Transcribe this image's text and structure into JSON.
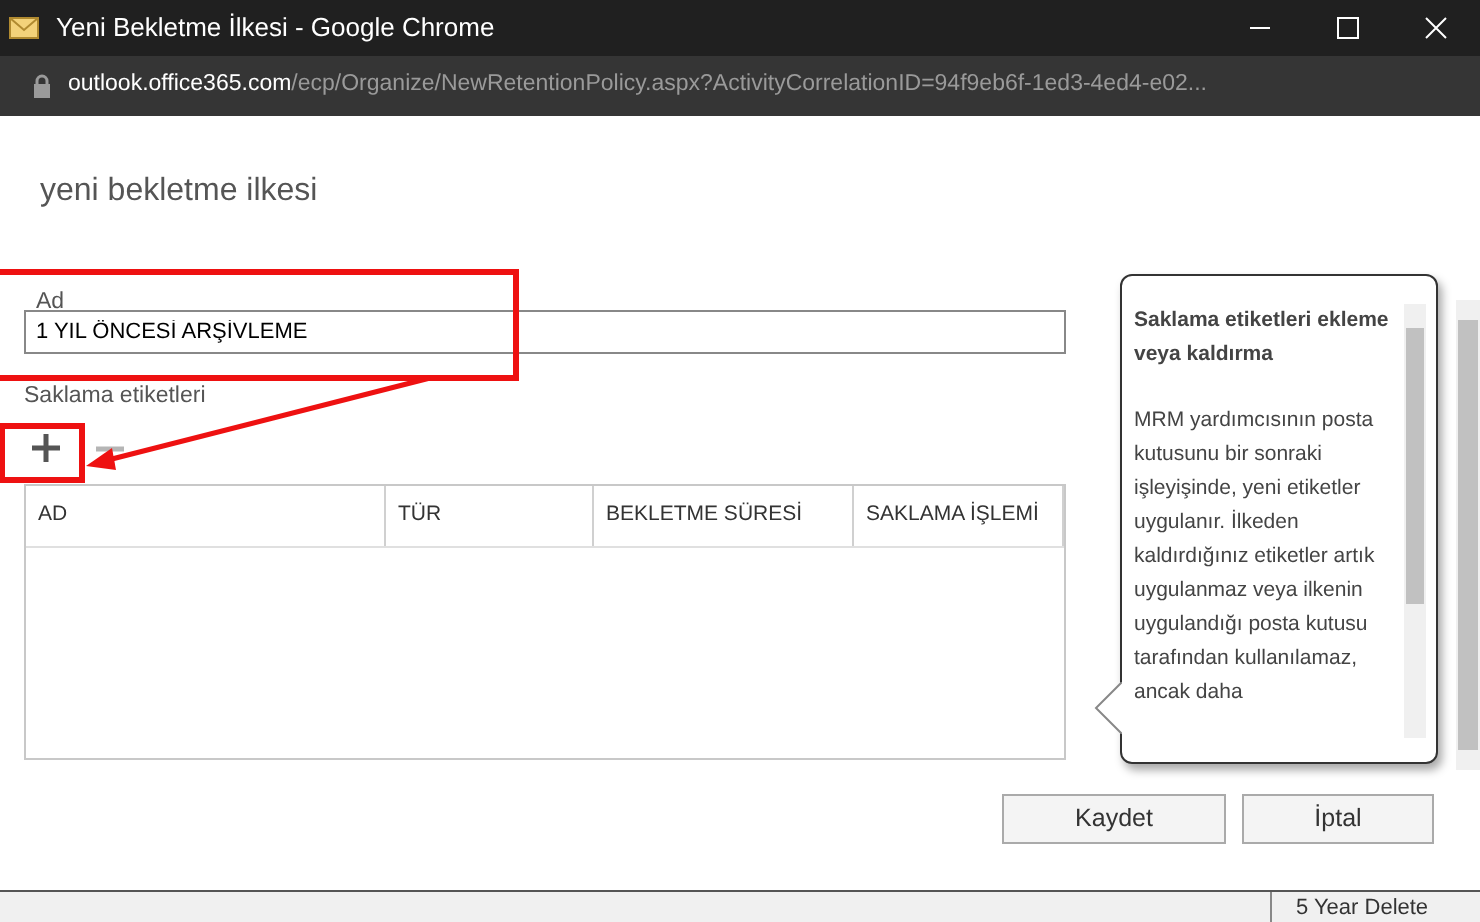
{
  "window": {
    "title": "Yeni Bekletme İlkesi - Google Chrome"
  },
  "address_bar": {
    "host": "outlook.office365.com",
    "path": "/ecp/Organize/NewRetentionPolicy.aspx?ActivityCorrelationID=94f9eb6f-1ed3-4ed4-e02..."
  },
  "dialog": {
    "heading": "yeni bekletme ilkesi",
    "name_field": {
      "label": "Ad",
      "value": "1 YIL ÖNCESİ ARŞİVLEME"
    },
    "tags_label": "Saklama etiketleri",
    "toolbar": [
      {
        "kind": "add",
        "disabled": false
      },
      {
        "kind": "remove",
        "disabled": true
      }
    ],
    "table": {
      "columns": [
        "AD",
        "TÜR",
        "BEKLETME SÜRESİ",
        "SAKLAMA İŞLEMİ"
      ]
    },
    "help": {
      "title": "Saklama etiketleri ekleme veya kaldırma",
      "body": "MRM yardımcısının posta kutusunu bir sonraki işleyişinde, yeni etiketler uygulanır. İlkeden kaldırdığınız etiketler artık uygulanmaz veya ilkenin uygulandığı posta kutusu tarafından kullanılamaz, ancak daha"
    },
    "buttons": [
      "Kaydet",
      "İptal"
    ]
  },
  "background_window": {
    "text": "5 Year Delete"
  }
}
